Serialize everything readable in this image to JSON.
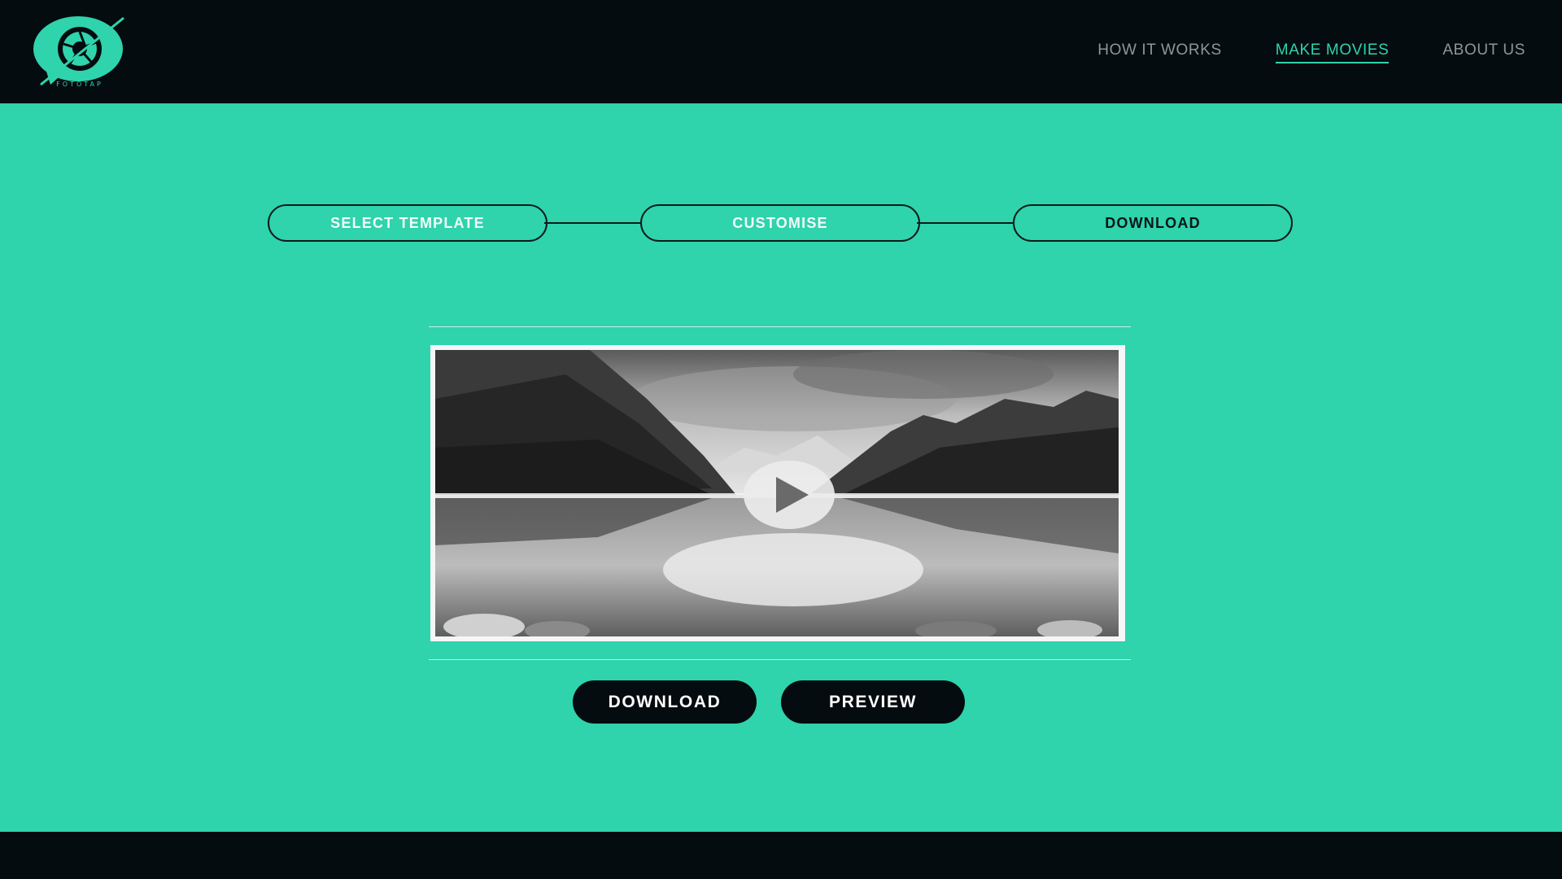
{
  "header": {
    "logo_icon": "aperture-logo-icon",
    "logo_text": "FOTOTAP",
    "nav": [
      {
        "label": "HOW IT WORKS",
        "active": false
      },
      {
        "label": "MAKE MOVIES",
        "active": true
      },
      {
        "label": "ABOUT US",
        "active": false
      }
    ]
  },
  "stepper": {
    "steps": [
      {
        "label": "SELECT TEMPLATE"
      },
      {
        "label": "CUSTOMISE"
      },
      {
        "label": "DOWNLOAD",
        "current": true
      }
    ]
  },
  "video": {
    "play_icon": "play-icon"
  },
  "actions": {
    "download_label": "DOWNLOAD",
    "preview_label": "PREVIEW"
  },
  "colors": {
    "accent": "#2fd3ac",
    "dark": "#050c0f",
    "nav_text": "#8c9797"
  }
}
